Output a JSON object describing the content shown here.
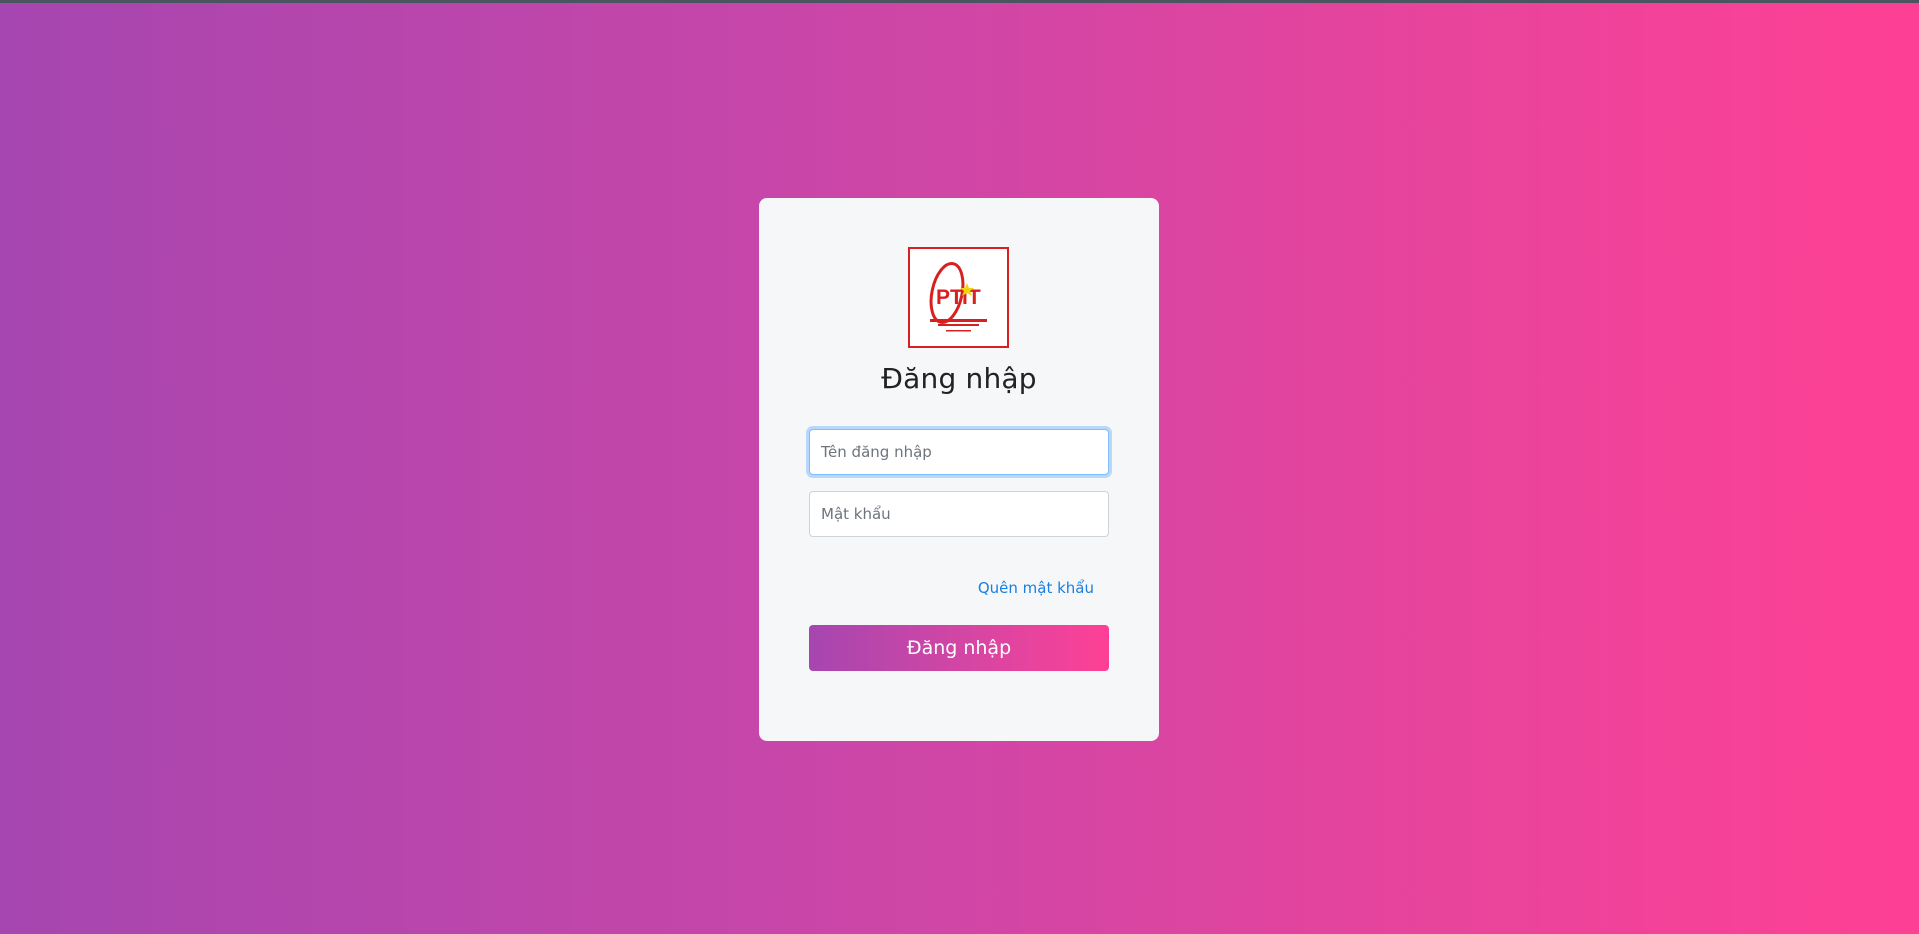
{
  "page": {
    "background_gradient": [
      "#a646b0",
      "#fe4095"
    ]
  },
  "login": {
    "logo_name": "ptit-logo",
    "title": "Đăng nhập",
    "username_placeholder": "Tên đăng nhập",
    "password_placeholder": "Mật khẩu",
    "forgot_label": "Quên mật khẩu",
    "submit_label": "Đăng nhập"
  },
  "colors": {
    "card": "#f6f7f9",
    "link": "#1a7fe0",
    "logo_red": "#d92020"
  }
}
